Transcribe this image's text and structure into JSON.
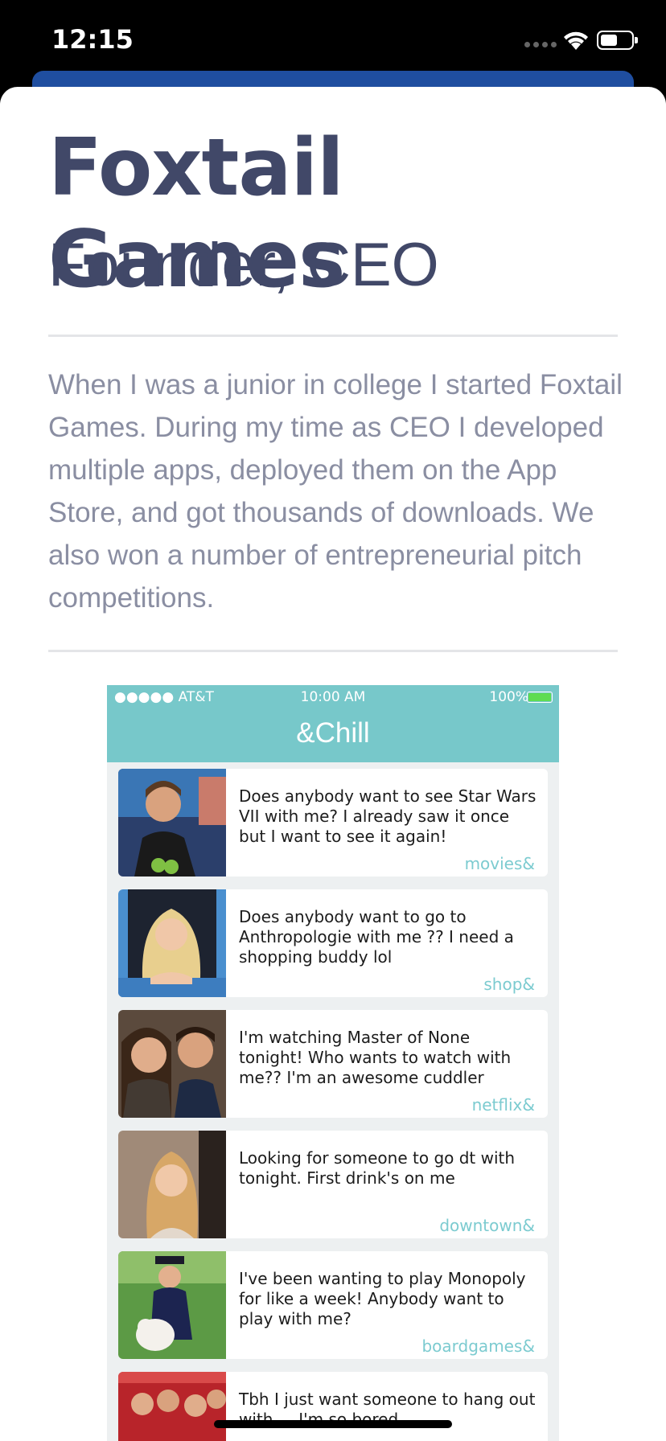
{
  "status_bar": {
    "time": "12:15"
  },
  "experience": {
    "company": "Foxtail Games",
    "role": "Founder, CEO",
    "description": "When I was a junior in college I started Foxtail Games. During my time as CEO I developed multiple apps, deployed them on the App Store, and got thousands of downloads. We also won a number of entrepreneurial pitch competitions."
  },
  "screenshot": {
    "carrier": "●●●●● AT&T",
    "clock": "10:00 AM",
    "battery_text": "100%",
    "app_title": "&Chill",
    "posts": [
      {
        "text": "Does anybody want to see Star Wars VII with me? I already saw it once but I want to see it again!",
        "tag": "movies&"
      },
      {
        "text": "Does anybody want to go to Anthropologie with me ?? I need a shopping buddy lol",
        "tag": "shop&"
      },
      {
        "text": "I'm watching Master of None tonight! Who wants to watch with me?? I'm an awesome cuddler",
        "tag": "netflix&"
      },
      {
        "text": "Looking for someone to go dt with tonight. First drink's on me",
        "tag": "downtown&"
      },
      {
        "text": "I've been wanting to play Monopoly for like a week! Anybody want to play with me?",
        "tag": "boardgames&"
      },
      {
        "text": "Tbh I just want someone to hang out with.... I'm so bored",
        "tag": ""
      }
    ]
  }
}
